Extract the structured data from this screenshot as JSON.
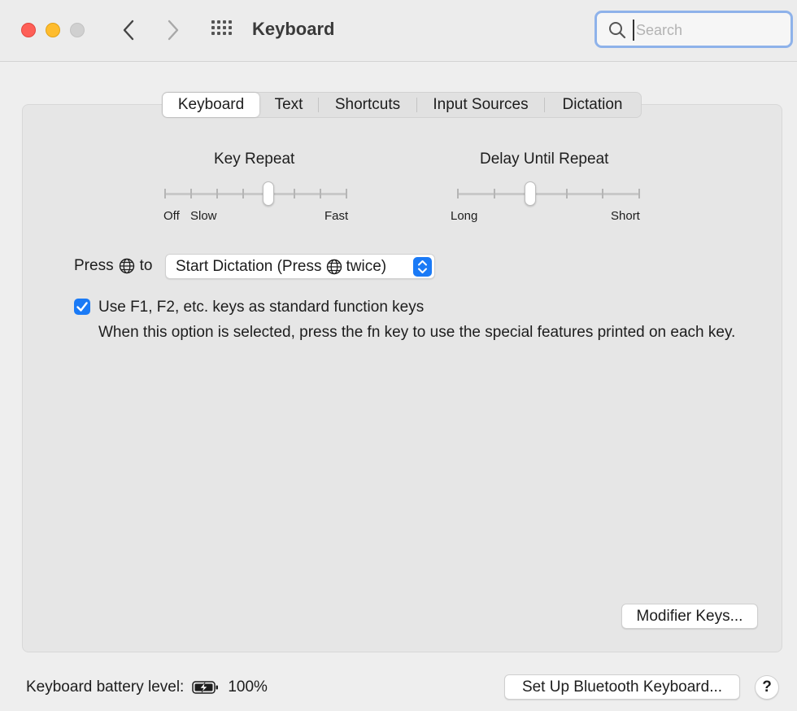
{
  "window": {
    "title": "Keyboard",
    "search_placeholder": "Search",
    "search_value": ""
  },
  "tabs": [
    {
      "label": "Keyboard",
      "active": true
    },
    {
      "label": "Text",
      "active": false
    },
    {
      "label": "Shortcuts",
      "active": false
    },
    {
      "label": "Input Sources",
      "active": false
    },
    {
      "label": "Dictation",
      "active": false
    }
  ],
  "key_repeat": {
    "title": "Key Repeat",
    "label_off": "Off",
    "label_slow": "Slow",
    "label_fast": "Fast",
    "tick_count": 8,
    "value_fraction": 0.57
  },
  "delay_until_repeat": {
    "title": "Delay Until Repeat",
    "label_long": "Long",
    "label_short": "Short",
    "tick_count": 6,
    "value_fraction": 0.4
  },
  "press_globe": {
    "label_prefix": "Press",
    "label_suffix": "to",
    "selected_option_prefix": "Start Dictation (Press",
    "selected_option_suffix": "twice)"
  },
  "function_keys": {
    "checked": true,
    "label": "Use F1, F2, etc. keys as standard function keys",
    "description": "When this option is selected, press the fn key to use the special features printed on each key."
  },
  "buttons": {
    "modifier_keys": "Modifier Keys...",
    "setup_bluetooth": "Set Up Bluetooth Keyboard...",
    "help": "?"
  },
  "battery": {
    "label": "Keyboard battery level:",
    "value": "100%"
  },
  "colors": {
    "accent": "#1a7af6",
    "close": "#fe5f57",
    "minimize": "#febc2e",
    "zoom_disabled": "#d0d0d0"
  }
}
